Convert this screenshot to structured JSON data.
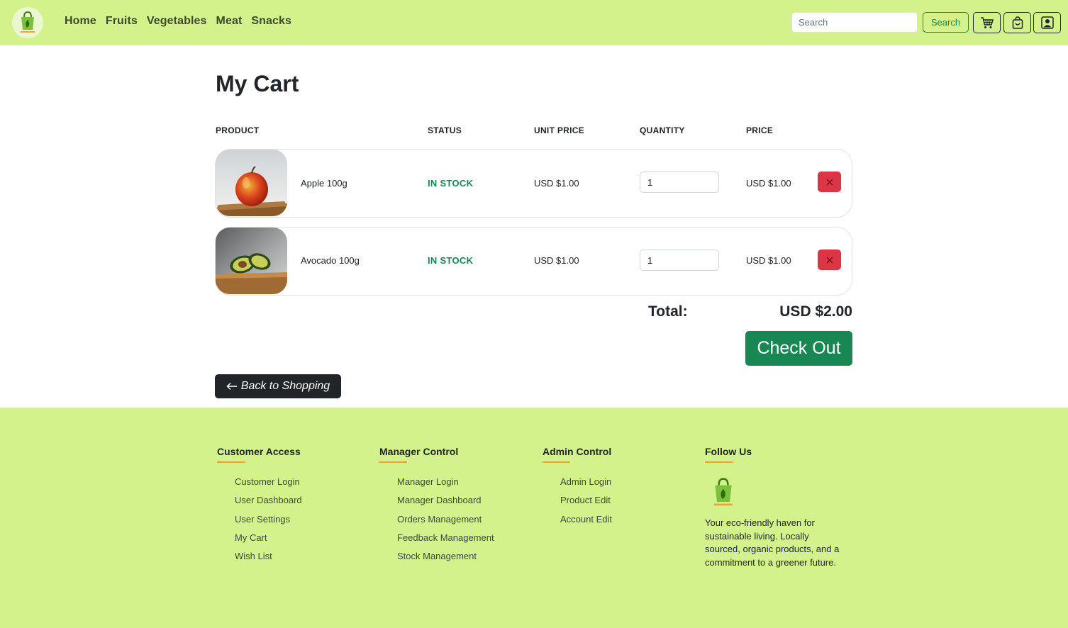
{
  "nav": {
    "links": [
      "Home",
      "Fruits",
      "Vegetables",
      "Meat",
      "Snacks"
    ],
    "search_placeholder": "Search",
    "search_label": "Search",
    "icons": [
      "cart-icon",
      "bag-icon",
      "user-icon"
    ],
    "bg_color": "#d3f28c"
  },
  "cart": {
    "title": "My Cart",
    "columns": [
      "PRODUCT",
      "STATUS",
      "UNIT PRICE",
      "QUANTITY",
      "PRICE"
    ],
    "items": [
      {
        "name": "Apple 100g",
        "status": "IN STOCK",
        "unit_price": "USD $1.00",
        "quantity": "1",
        "price": "USD $1.00",
        "image": "apple-image"
      },
      {
        "name": "Avocado 100g",
        "status": "IN STOCK",
        "unit_price": "USD $1.00",
        "quantity": "1",
        "price": "USD $1.00",
        "image": "avocado-image"
      }
    ],
    "total_label": "Total:",
    "total_value": "USD $2.00",
    "checkout_label": "Check Out",
    "back_label": "Back to Shopping",
    "status_color": "#198754",
    "remove_color": "#dc3545"
  },
  "footer": {
    "customer": {
      "heading": "Customer Access",
      "links": [
        "Customer Login",
        "User Dashboard",
        "User Settings",
        "My Cart",
        "Wish List"
      ]
    },
    "manager": {
      "heading": "Manager Control",
      "links": [
        "Manager Login",
        "Manager Dashboard",
        "Orders Management",
        "Feedback Management",
        "Stock Management"
      ]
    },
    "admin": {
      "heading": "Admin Control",
      "links": [
        "Admin Login",
        "Product Edit",
        "Account Edit"
      ]
    },
    "follow": {
      "heading": "Follow Us",
      "description": "Your eco-friendly haven for sustainable living. Locally sourced, organic products, and a commitment to a greener future."
    },
    "accent_color": "#f0a030"
  }
}
